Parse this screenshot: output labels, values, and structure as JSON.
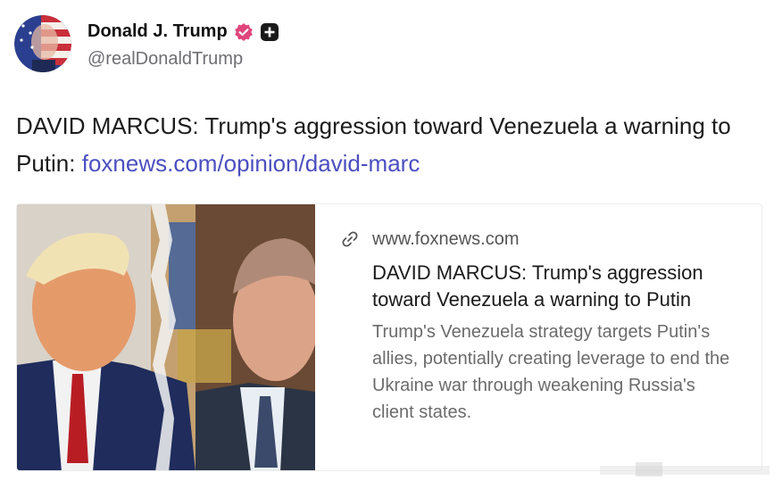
{
  "author": {
    "display_name": "Donald J. Trump",
    "handle": "@realDonaldTrump",
    "verified_icon": "verified-badge-icon",
    "extra_badge_icon": "plus-badge-icon",
    "avatar_icon": "avatar-flag-portrait"
  },
  "post": {
    "text_before_link": "DAVID MARCUS: Trump's aggression toward Venezuela a warning to Putin: ",
    "link_text": "foxnews.com/opinion/david-marc",
    "link_color": "#4b4fbf"
  },
  "link_card": {
    "domain": "www.foxnews.com",
    "domain_icon": "link-chain-icon",
    "title": "DAVID MARCUS: Trump's aggression toward Venezuela a warning to Putin",
    "description": "Trump's Venezuela strategy targets Putin's allies, potentially creating leverage to end the Ukraine war through weakening Russia's client states.",
    "image_icon": "trump-putin-photo"
  },
  "colors": {
    "verified_badge": "#e0457b",
    "text_primary": "#1a1a1a",
    "text_secondary": "#6b6b6b"
  }
}
